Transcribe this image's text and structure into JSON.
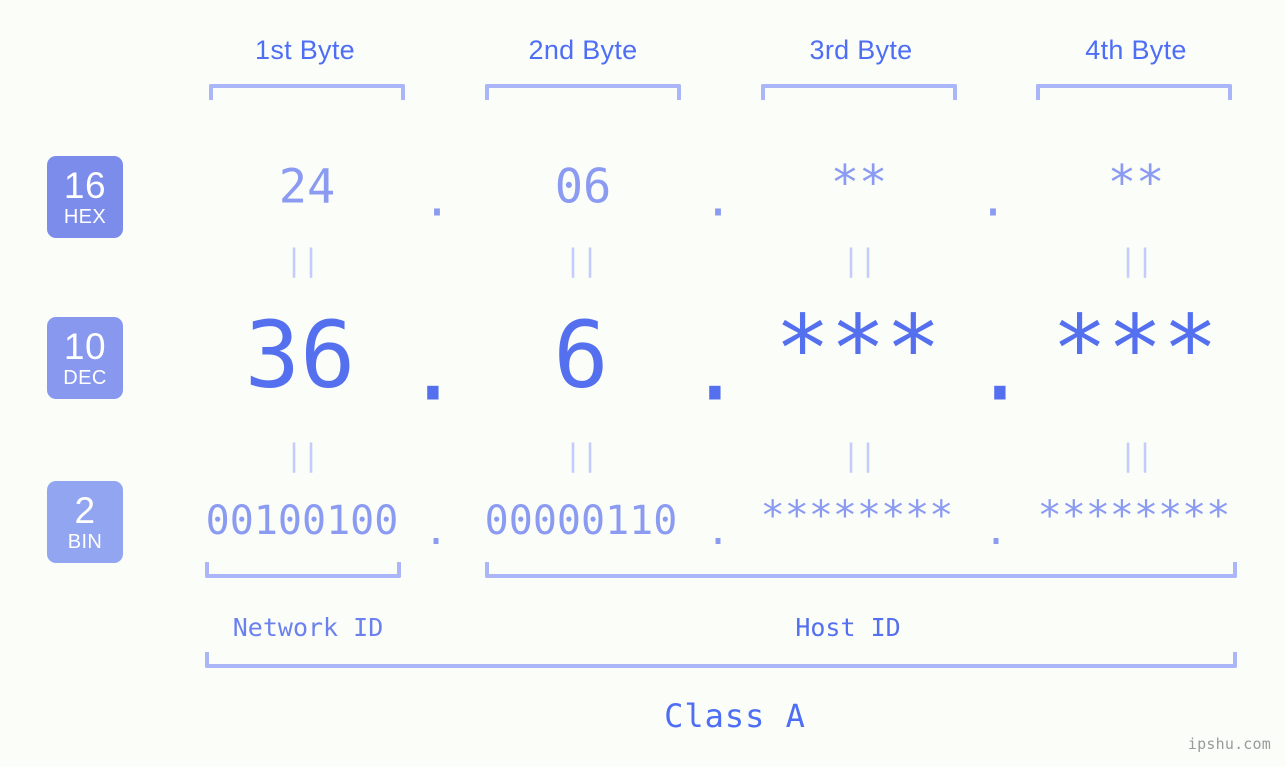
{
  "page": {
    "background": "#fbfdf8",
    "accent": "#5570ef",
    "accent_light": "#8b9bf2",
    "bracket_color": "#aab6f7"
  },
  "byte_headers": [
    {
      "label": "1st Byte"
    },
    {
      "label": "2nd Byte"
    },
    {
      "label": "3rd Byte"
    },
    {
      "label": "4th Byte"
    }
  ],
  "bases": [
    {
      "number": "16",
      "name": "HEX",
      "color": "#7b8cea"
    },
    {
      "number": "10",
      "name": "DEC",
      "color": "#8798ee"
    },
    {
      "number": "2",
      "name": "BIN",
      "color": "#91a5f0"
    }
  ],
  "rows": {
    "hex": {
      "base_number": "16",
      "base_name": "HEX",
      "values": [
        "24",
        "06",
        "**",
        "**"
      ],
      "separators": [
        ".",
        ".",
        "."
      ]
    },
    "dec": {
      "base_number": "10",
      "base_name": "DEC",
      "values": [
        "36",
        "6",
        "***",
        "***"
      ],
      "separators": [
        ".",
        ".",
        "."
      ]
    },
    "bin": {
      "base_number": "2",
      "base_name": "BIN",
      "values": [
        "00100100",
        "00000110",
        "********",
        "********"
      ],
      "separators": [
        ".",
        ".",
        "."
      ]
    }
  },
  "equals_marks": {
    "glyph": "||",
    "hex_to_dec_count": 4,
    "dec_to_bin_count": 4
  },
  "sections": [
    {
      "label": "Network ID"
    },
    {
      "label": "Host ID"
    }
  ],
  "class_label": "Class A",
  "watermark": "ipshu.com"
}
